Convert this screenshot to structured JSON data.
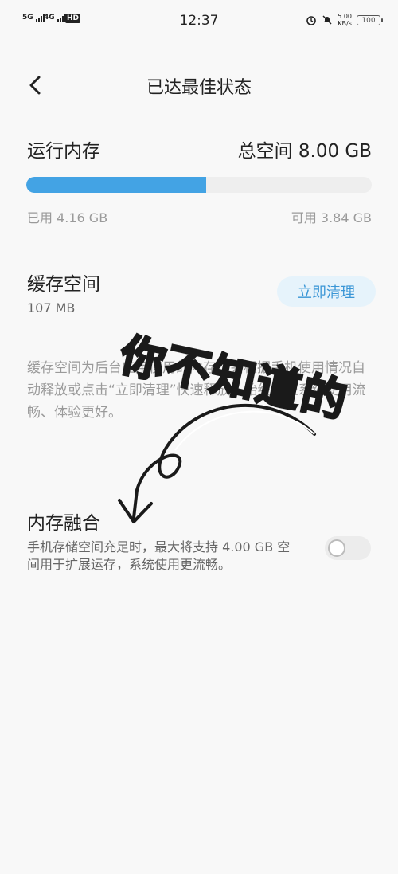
{
  "status_bar": {
    "sim1_type": "5G",
    "sim2_type": "4G",
    "hd_label": "HD",
    "time": "12:37",
    "net_speed_value": "5.00",
    "net_speed_unit": "KB/s",
    "battery_level": "100"
  },
  "nav": {
    "title": "已达最佳状态"
  },
  "ram": {
    "title": "运行内存",
    "total_label": "总空间 8.00 GB",
    "used_label": "已用 4.16 GB",
    "free_label": "可用 3.84 GB",
    "used_fraction": 0.52
  },
  "cache": {
    "title": "缓存空间",
    "size": "107 MB",
    "clean_button": "立即清理",
    "description": "缓存空间为后台应用使用的内存，会根据手机使用情况自动释放或点击“立即清理”快速释放，始终保证系统使用流畅、体验更好。"
  },
  "fusion": {
    "title": "内存融合",
    "description": "手机存储空间充足时，最大将支持 4.00 GB 空间用于扩展运存，系统使用更流畅。",
    "enabled": false
  },
  "overlay": {
    "handwritten_text": "你不知道的"
  },
  "colors": {
    "accent": "#43a3e4",
    "button_bg": "#e6f3fb",
    "button_text": "#3a96d6",
    "secondary_text": "#9a9a9a"
  }
}
